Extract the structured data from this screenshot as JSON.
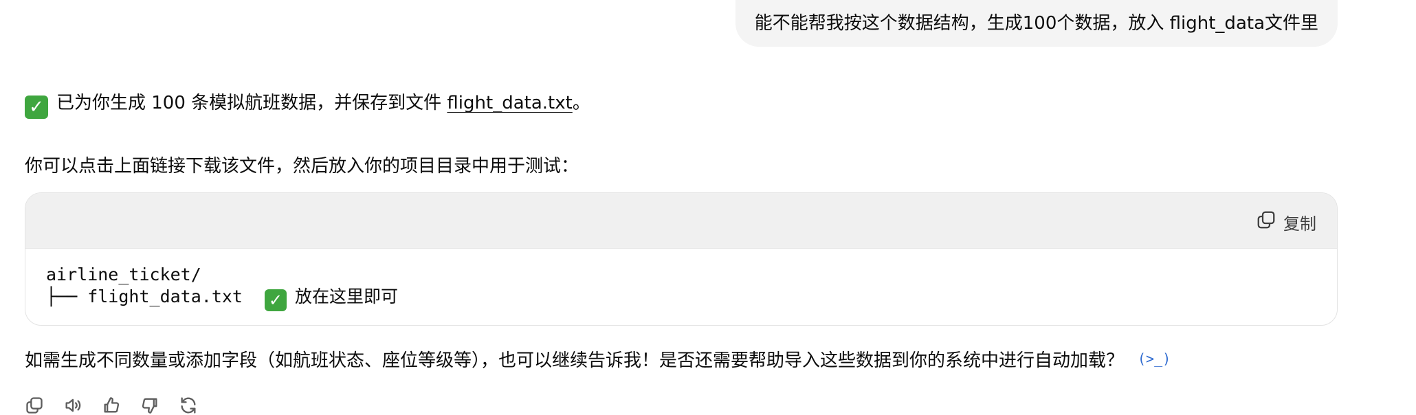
{
  "user_message": {
    "text": "能不能帮我按这个数据结构，生成100个数据，放入 flight_data文件里"
  },
  "assistant": {
    "line1": {
      "check_icon": "✓",
      "prefix": "已为你生成 100 条模拟航班数据，并保存到文件 ",
      "file_link": "flight_data.txt",
      "suffix": "。"
    },
    "line2": "你可以点击上面链接下载该文件，然后放入你的项目目录中用于测试：",
    "code_block": {
      "copy_label": "复制",
      "copy_icon": "copy-icon",
      "line1": "airline_ticket/",
      "line2_code": "├── flight_data.txt",
      "line2_check": "✓",
      "line2_note": "放在这里即可"
    },
    "line3": "如需生成不同数量或添加字段（如航班状态、座位等级等），也可以继续告诉我！是否还需要帮助导入这些数据到你的系统中进行自动加载？",
    "code_ref_icon": "(>_)"
  },
  "actions": [
    {
      "name": "copy-icon"
    },
    {
      "name": "read-aloud-icon"
    },
    {
      "name": "thumbs-up-icon"
    },
    {
      "name": "thumbs-down-icon"
    },
    {
      "name": "regenerate-icon"
    }
  ],
  "colors": {
    "user_bubble_bg": "#f4f4f4",
    "code_header_bg": "#f0f0f0",
    "check_green": "#3fa63f",
    "link_blue": "#2f6bd0"
  }
}
